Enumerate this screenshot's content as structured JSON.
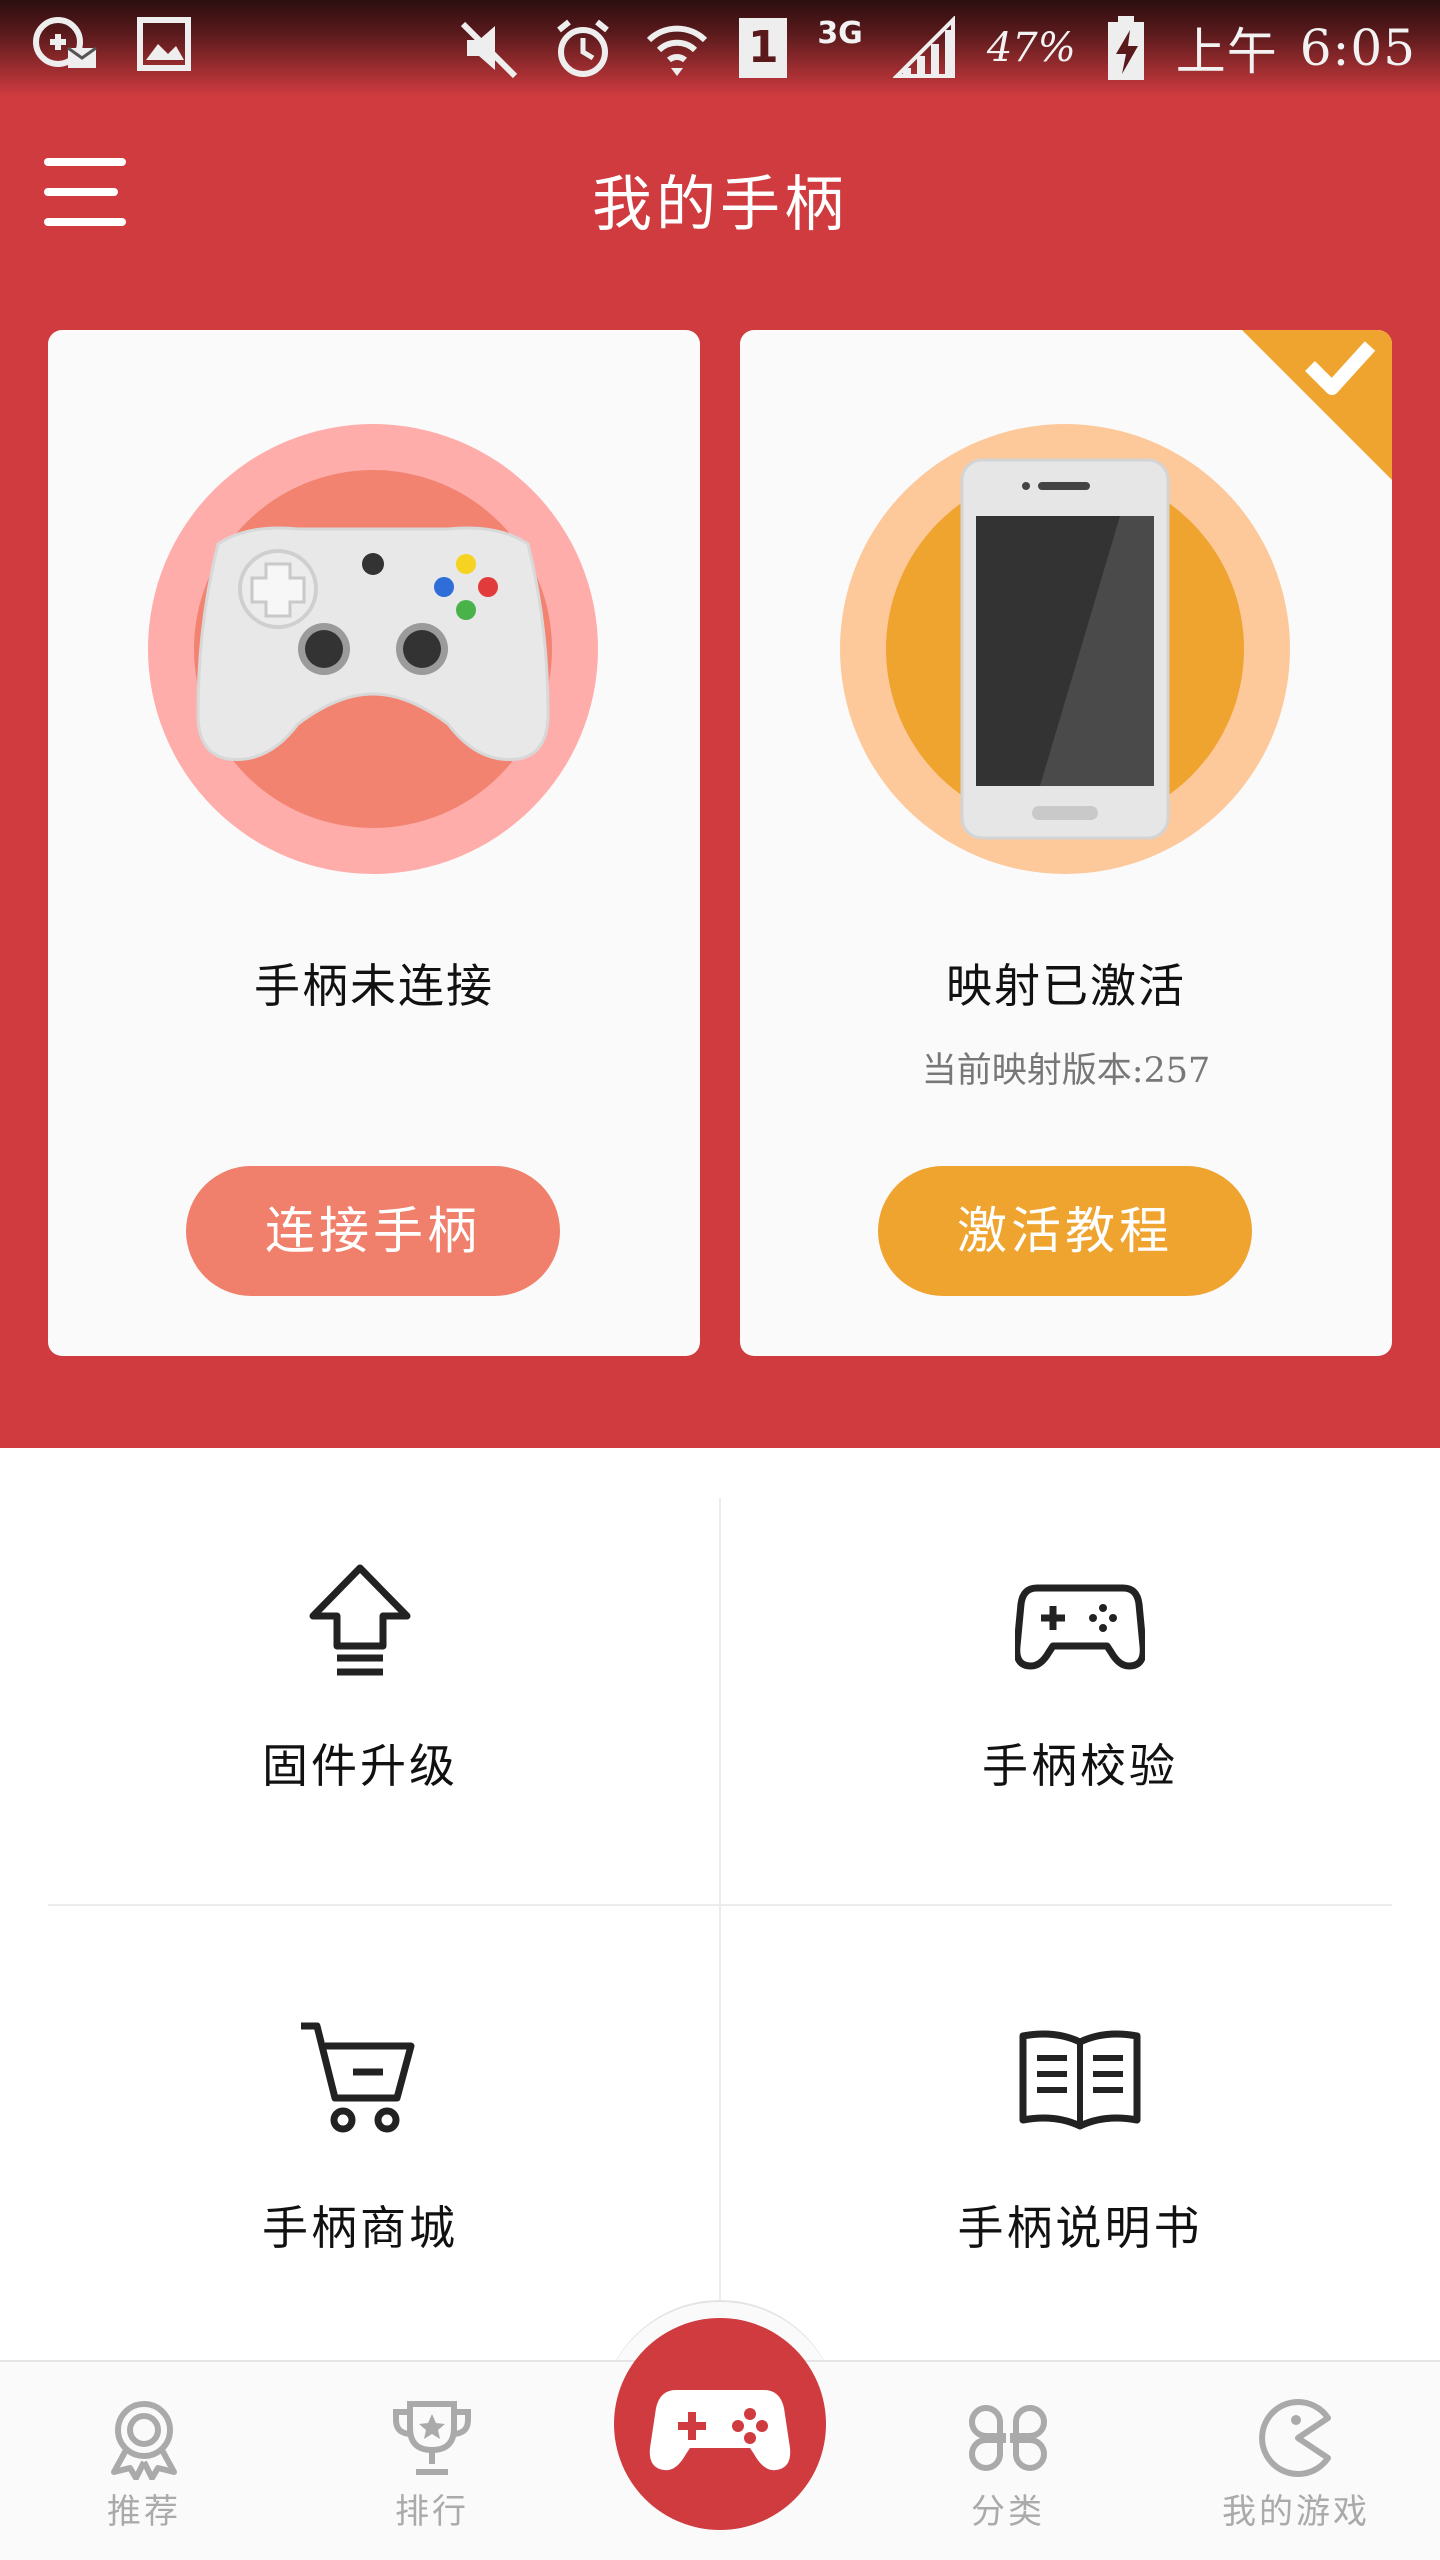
{
  "status_bar": {
    "battery": "47%",
    "network": "3G",
    "sim": "1",
    "time_period": "上午",
    "time": "6:05"
  },
  "header": {
    "title": "我的手柄"
  },
  "cards": {
    "gamepad": {
      "status": "手柄未连接",
      "button": "连接手柄",
      "accent": "#f07f6c"
    },
    "mapping": {
      "status": "映射已激活",
      "version_text": "当前映射版本:257",
      "button": "激活教程",
      "accent": "#f0a430"
    }
  },
  "functions": {
    "firmware": "固件升级",
    "calibrate": "手柄校验",
    "store": "手柄商城",
    "manual": "手柄说明书"
  },
  "bottom_nav": {
    "recommend": "推荐",
    "ranking": "排行",
    "category": "分类",
    "my_games": "我的游戏"
  },
  "colors": {
    "primary_red": "#cf3b3f",
    "card_bg": "#fafafa"
  },
  "icons": {
    "menu": "hamburger-icon",
    "checkmark": "check-icon",
    "firmware": "upload-arrow-icon",
    "calibrate": "gamepad-icon",
    "store": "cart-icon",
    "manual": "book-icon",
    "recommend": "medal-icon",
    "ranking": "trophy-icon",
    "center": "gamepad-icon",
    "category": "four-leaf-icon",
    "my_games": "pacman-icon"
  }
}
